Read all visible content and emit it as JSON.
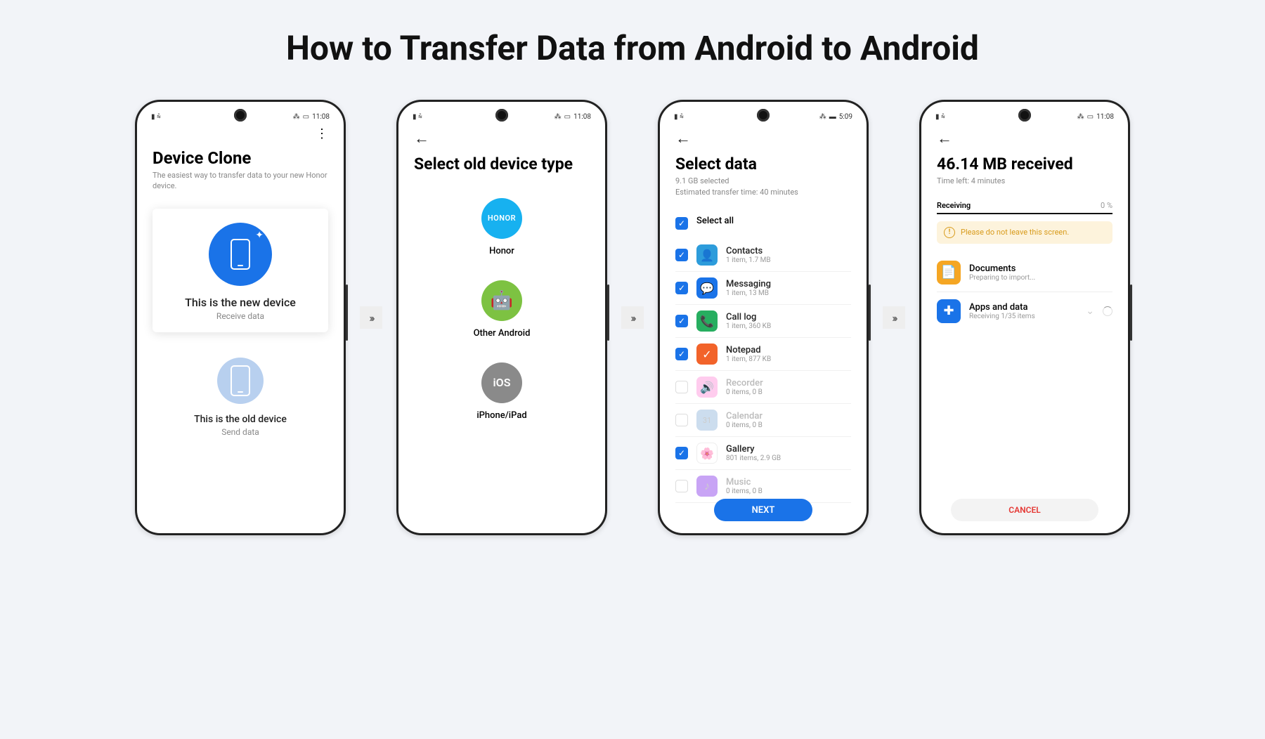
{
  "title": "How to Transfer Data from Android to Android",
  "arrow_glyph": "›››",
  "phones": {
    "p1": {
      "status_time": "11:08",
      "heading": "Device Clone",
      "sub": "The easiest way to transfer data to your new Honor device.",
      "new_title": "This is the new device",
      "new_sub": "Receive data",
      "old_title": "This is the old device",
      "old_sub": "Send data"
    },
    "p2": {
      "status_time": "11:08",
      "heading": "Select old device type",
      "honor_label": "Honor",
      "honor_badge": "HONOR",
      "android_label": "Other Android",
      "ios_label": "iPhone/iPad",
      "ios_badge": "iOS"
    },
    "p3": {
      "status_time": "5:09",
      "heading": "Select data",
      "sub1": "9.1 GB selected",
      "sub2": "Estimated transfer time: 40 minutes",
      "select_all": "Select all",
      "items": [
        {
          "name": "Contacts",
          "sub": "1 item, 1.7 MB",
          "checked": true,
          "color": "#2d9cdb",
          "icon": "👤"
        },
        {
          "name": "Messaging",
          "sub": "1 item, 13 MB",
          "checked": true,
          "color": "#1a73e8",
          "icon": "💬"
        },
        {
          "name": "Call log",
          "sub": "1 item, 360 KB",
          "checked": true,
          "color": "#27ae60",
          "icon": "📞"
        },
        {
          "name": "Notepad",
          "sub": "1 item, 877 KB",
          "checked": true,
          "color": "#f2632a",
          "icon": "✓"
        },
        {
          "name": "Recorder",
          "sub": "0 items, 0 B",
          "checked": false,
          "color": "#fce",
          "icon": "🔊",
          "disabled": true
        },
        {
          "name": "Calendar",
          "sub": "0 items, 0 B",
          "checked": false,
          "color": "#cde",
          "icon": "31",
          "disabled": true
        },
        {
          "name": "Gallery",
          "sub": "801 items, 2.9 GB",
          "checked": true,
          "color": "#fff",
          "icon": "🌸"
        },
        {
          "name": "Music",
          "sub": "0 items, 0 B",
          "checked": false,
          "color": "#c8a4f5",
          "icon": "♪",
          "disabled": true
        }
      ],
      "next": "NEXT"
    },
    "p4": {
      "status_time": "11:08",
      "heading": "46.14 MB received",
      "sub": "Time left: 4 minutes",
      "recv_label": "Receiving",
      "recv_pct": "0 %",
      "warn": "Please do not leave this screen.",
      "docs_title": "Documents",
      "docs_sub": "Preparing to import...",
      "apps_title": "Apps and data",
      "apps_sub": "Receiving 1/35 items",
      "cancel": "CANCEL"
    }
  }
}
